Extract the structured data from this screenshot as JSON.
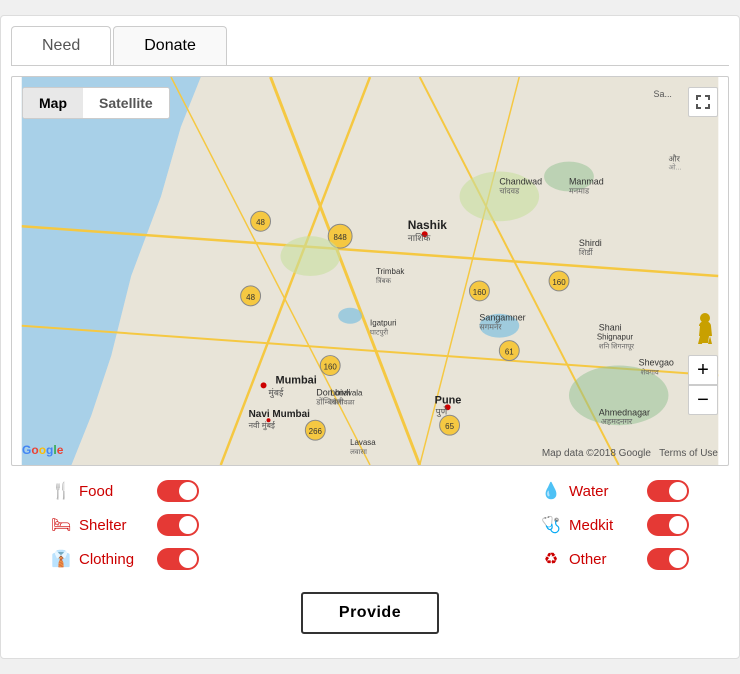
{
  "tabs": [
    {
      "id": "need",
      "label": "Need",
      "active": false
    },
    {
      "id": "donate",
      "label": "Donate",
      "active": true
    }
  ],
  "map": {
    "view_map_label": "Map",
    "view_satellite_label": "Satellite",
    "zoom_in_label": "+",
    "zoom_out_label": "−",
    "copyright": "Map data ©2018 Google",
    "terms": "Terms of Use"
  },
  "toggles": {
    "left": [
      {
        "id": "food",
        "icon": "🍴",
        "label": "Food",
        "enabled": true
      },
      {
        "id": "shelter",
        "icon": "🛏",
        "label": "Shelter",
        "enabled": true
      },
      {
        "id": "clothing",
        "icon": "👔",
        "label": "Clothing",
        "enabled": true
      }
    ],
    "right": [
      {
        "id": "water",
        "icon": "💧",
        "label": "Water",
        "enabled": true
      },
      {
        "id": "medkit",
        "icon": "🩺",
        "label": "Medkit",
        "enabled": true
      },
      {
        "id": "other",
        "icon": "♻",
        "label": "Other",
        "enabled": true
      }
    ]
  },
  "provide_button": "Provide",
  "colors": {
    "active_red": "#cc0000",
    "toggle_on": "#e53935"
  }
}
